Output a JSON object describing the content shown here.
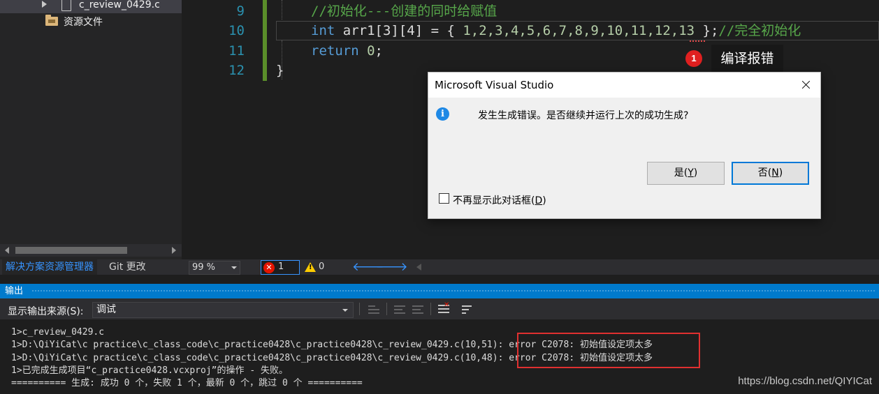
{
  "solution_explorer": {
    "file_item": "c_review_0429.c",
    "folder_item": "资源文件"
  },
  "panel_tabs": {
    "active": "解决方案资源管理器",
    "inactive": "Git 更改"
  },
  "editor": {
    "line_numbers": [
      "9",
      "10",
      "11",
      "12"
    ],
    "line9_comment": "//初始化---创建的同时给赋值",
    "line10_kw": "int",
    "line10_decl": " arr1[3][4] = { ",
    "line10_values": "1,2,3,4,5,6,7,8,9,10,11,12,13",
    "line10_end": " };",
    "line10_comment": "//完全初始化",
    "line11_kw": "return",
    "line11_value": "0",
    "line11_end": ";",
    "line12": "}"
  },
  "status_strip": {
    "zoom": "99 %",
    "error_count": "1",
    "warning_count": "0",
    "back_arrow": "🡐",
    "forward_arrow": "🡒"
  },
  "output": {
    "title": "输出",
    "source_label": "显示输出来源(S):",
    "source_value": "调试",
    "lines": [
      "1>c_review_0429.c",
      "1>D:\\QiYiCat\\c practice\\c_class_code\\c_practice0428\\c_practice0428\\c_review_0429.c(10,51): error C2078: 初始值设定项太多",
      "1>D:\\QiYiCat\\c practice\\c_class_code\\c_practice0428\\c_practice0428\\c_review_0429.c(10,48): error C2078: 初始值设定项太多",
      "1>已完成生成项目“c_practice0428.vcxproj”的操作 - 失败。",
      "========== 生成: 成功 0 个，失败 1 个，最新 0 个，跳过 0 个 =========="
    ],
    "watermark": "https://blog.csdn.net/QIYICat"
  },
  "dialog": {
    "title": "Microsoft Visual Studio",
    "message": "发生生成错误。是否继续并运行上次的成功生成?",
    "yes_label": "是(",
    "yes_key": "Y",
    "yes_end": ")",
    "no_label": "否(",
    "no_key": "N",
    "no_end": ")",
    "checkbox_label": "不再显示此对话框(",
    "checkbox_key": "D",
    "checkbox_end": ")"
  },
  "annotation": {
    "badge": "1",
    "label": "编译报错"
  },
  "icons": {
    "error": "error-circle-icon",
    "warning": "warning-triangle-icon",
    "info": "info-icon",
    "close": "close-icon",
    "folder": "folder-icon",
    "file": "c-file-icon"
  },
  "colors": {
    "accent": "#007acc",
    "error": "#e51400",
    "annotation_red": "#e02020"
  }
}
